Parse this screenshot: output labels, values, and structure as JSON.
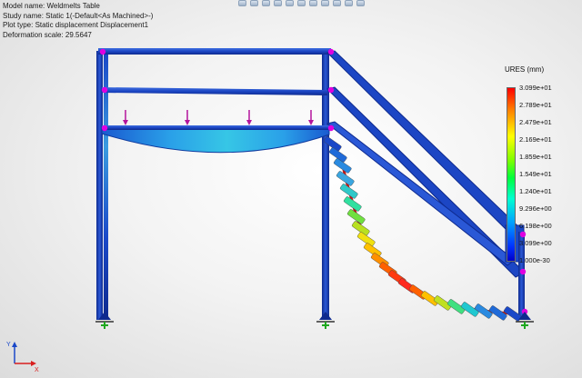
{
  "info": {
    "model_name": "Model name: Weldmelts Table",
    "study_name": "Study name: Static 1(-Default<As Machined>-)",
    "plot_type": "Plot type: Static displacement Displacement1",
    "deformation_scale": "Deformation scale: 29.5647"
  },
  "legend": {
    "title": "URES (mm)",
    "values": [
      "3.099e+01",
      "2.789e+01",
      "2.479e+01",
      "2.169e+01",
      "1.859e+01",
      "1.549e+01",
      "1.240e+01",
      "9.296e+00",
      "6.198e+00",
      "3.099e+00",
      "1.000e-30"
    ]
  },
  "triad": {
    "y_axis": "Y",
    "x_axis": "X"
  },
  "colors": {
    "frame_blue": "#1a48c8",
    "load_arrow": "#b4149c",
    "joint": "#e000e0",
    "fixture": "#1fa81f"
  }
}
